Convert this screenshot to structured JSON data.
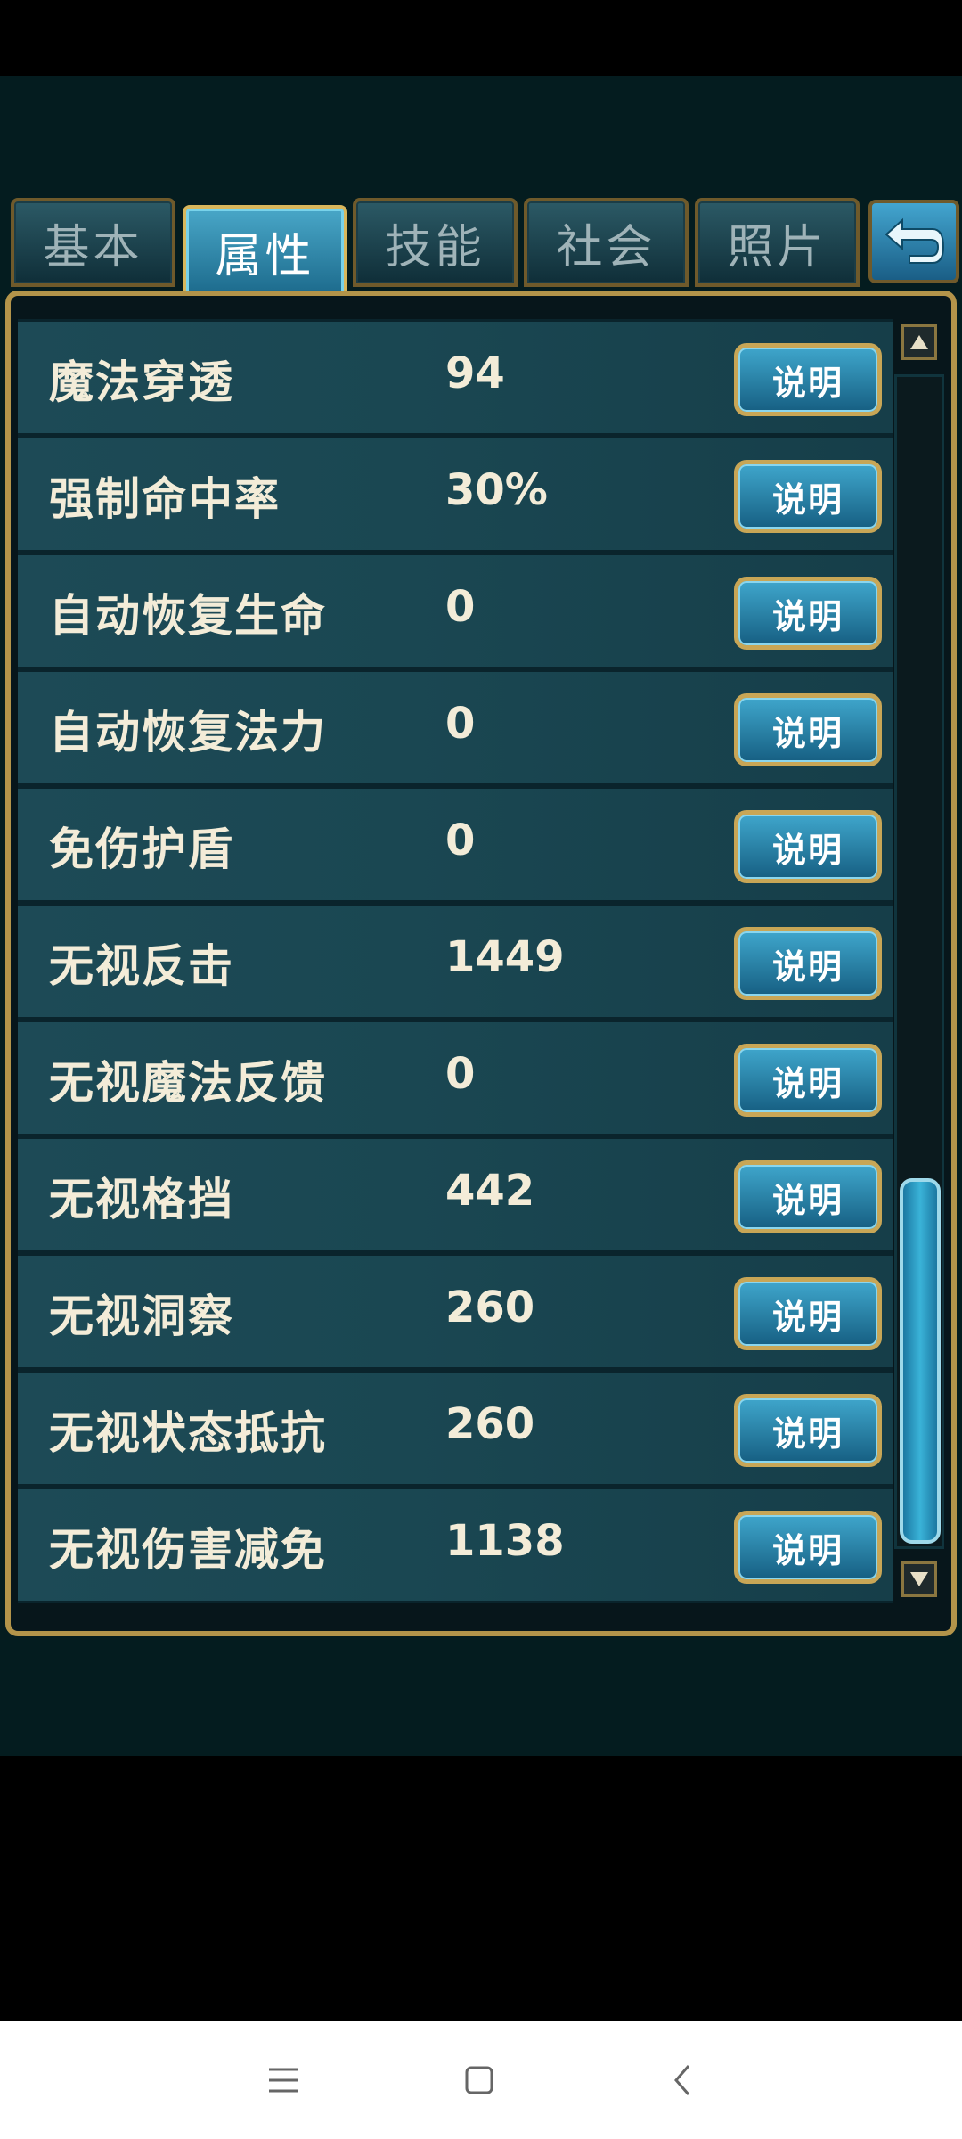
{
  "tabs": [
    {
      "label": "基本",
      "active": false
    },
    {
      "label": "属性",
      "active": true
    },
    {
      "label": "技能",
      "active": false
    },
    {
      "label": "社会",
      "active": false
    },
    {
      "label": "照片",
      "active": false
    }
  ],
  "rows": [
    {
      "name": "魔法穿透",
      "value": "94",
      "button": "说明"
    },
    {
      "name": "强制命中率",
      "value": "30%",
      "button": "说明"
    },
    {
      "name": "自动恢复生命",
      "value": "0",
      "button": "说明"
    },
    {
      "name": "自动恢复法力",
      "value": "0",
      "button": "说明"
    },
    {
      "name": "免伤护盾",
      "value": "0",
      "button": "说明"
    },
    {
      "name": "无视反击",
      "value": "1449",
      "button": "说明"
    },
    {
      "name": "无视魔法反馈",
      "value": "0",
      "button": "说明"
    },
    {
      "name": "无视格挡",
      "value": "442",
      "button": "说明"
    },
    {
      "name": "无视洞察",
      "value": "260",
      "button": "说明"
    },
    {
      "name": "无视状态抵抗",
      "value": "260",
      "button": "说明"
    },
    {
      "name": "无视伤害减免",
      "value": "1138",
      "button": "说明"
    }
  ],
  "scroll": {
    "position_fraction": 1.0
  },
  "colors": {
    "accent_gold": "#d8b75c",
    "tab_active": "#49a7c8",
    "row_bg": "#1d4a56"
  }
}
